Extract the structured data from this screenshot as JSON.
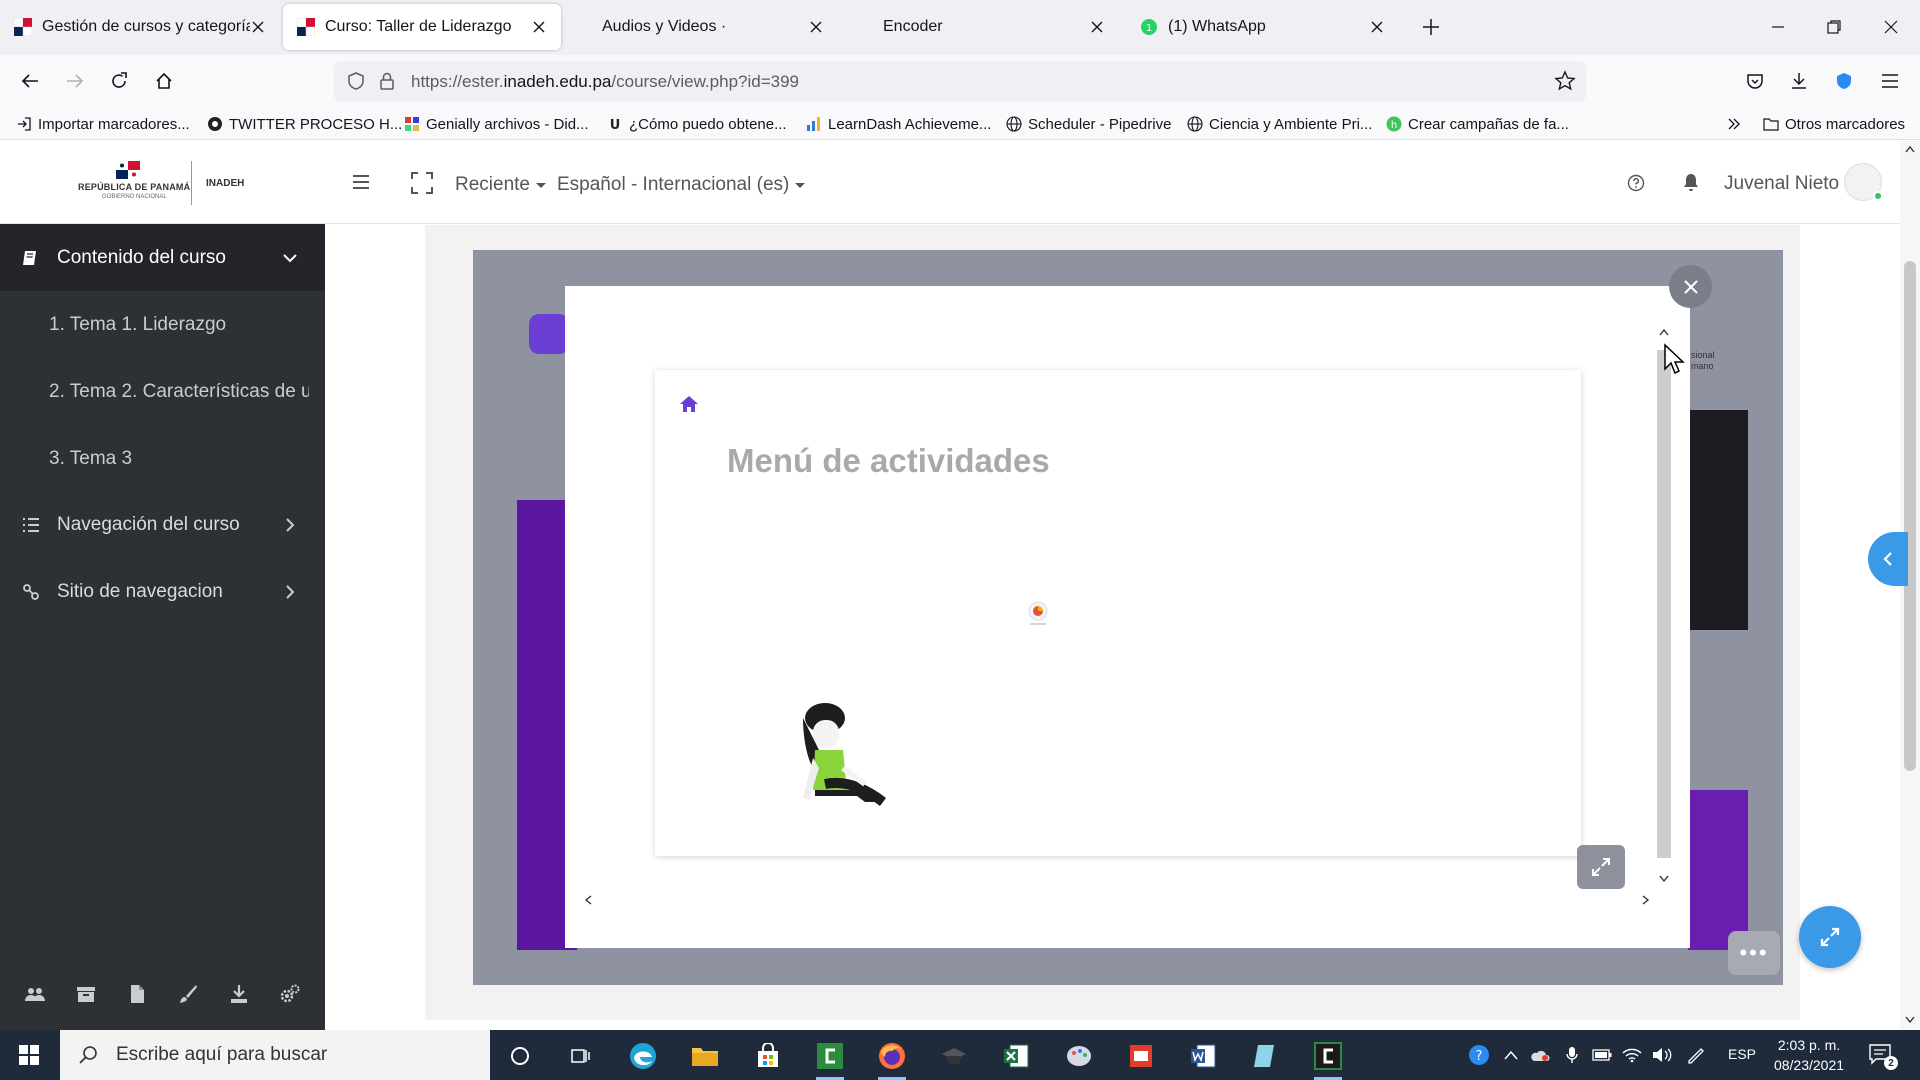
{
  "browser": {
    "tabs": [
      {
        "title": "Gestión de cursos y categorías",
        "active": false
      },
      {
        "title": "Curso: Taller de Liderazgo",
        "active": true
      },
      {
        "title": "Audios y Videos ·",
        "active": false
      },
      {
        "title": "Encoder",
        "active": false
      },
      {
        "title": "(1) WhatsApp",
        "active": false
      }
    ],
    "url_prefix": "https://ester.",
    "url_domain": "inadeh.edu.pa",
    "url_path": "/course/view.php?id=399",
    "bookmarks": [
      "Importar marcadores...",
      "TWITTER PROCESO H...",
      "Genially archivos - Did...",
      "¿Cómo puedo obtene...",
      "LearnDash Achieveme...",
      "Scheduler - Pipedrive",
      "Ciencia y Ambiente Pri...",
      "Crear campañas de fa..."
    ],
    "other_bookmarks": "Otros marcadores"
  },
  "header": {
    "logo_line1": "REPÚBLICA DE PANAMÁ",
    "logo_line2": "GOBIERNO NACIONAL",
    "logo_org": "INADEH",
    "menu_recent": "Reciente",
    "menu_language": "Español - Internacional (es)",
    "user_name": "Juvenal Nieto"
  },
  "sidebar": {
    "course_content": "Contenido del curso",
    "topics": [
      "1. Tema 1. Liderazgo",
      "2. Tema 2. Características de u",
      "3. Tema 3"
    ],
    "course_nav": "Navegación del curso",
    "site_nav": "Sitio de navegacion"
  },
  "content": {
    "card_title": "Menú de actividades",
    "stage_tag": "sional\nmano",
    "dots": "•••"
  },
  "taskbar": {
    "search_placeholder": "Escribe aquí para buscar",
    "lang": "ESP",
    "time": "2:03 p. m.",
    "date": "08/23/2021",
    "notifications": "2"
  },
  "colors": {
    "sidebar_bg": "#2d3035",
    "accent_blue": "#3b9ae8",
    "home_purple": "#6b3fd4",
    "stage_purple": "#5a16a0"
  }
}
